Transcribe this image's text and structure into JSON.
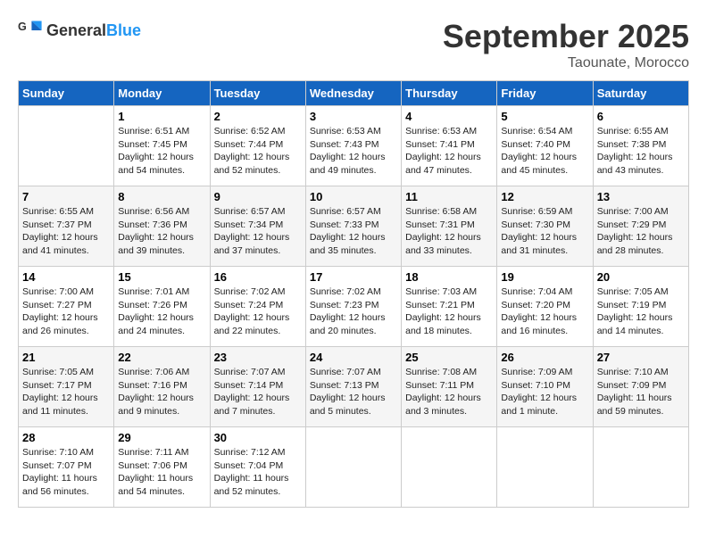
{
  "header": {
    "logo_general": "General",
    "logo_blue": "Blue",
    "month": "September 2025",
    "location": "Taounate, Morocco"
  },
  "days_of_week": [
    "Sunday",
    "Monday",
    "Tuesday",
    "Wednesday",
    "Thursday",
    "Friday",
    "Saturday"
  ],
  "weeks": [
    [
      {
        "day": "",
        "info": ""
      },
      {
        "day": "1",
        "info": "Sunrise: 6:51 AM\nSunset: 7:45 PM\nDaylight: 12 hours\nand 54 minutes."
      },
      {
        "day": "2",
        "info": "Sunrise: 6:52 AM\nSunset: 7:44 PM\nDaylight: 12 hours\nand 52 minutes."
      },
      {
        "day": "3",
        "info": "Sunrise: 6:53 AM\nSunset: 7:43 PM\nDaylight: 12 hours\nand 49 minutes."
      },
      {
        "day": "4",
        "info": "Sunrise: 6:53 AM\nSunset: 7:41 PM\nDaylight: 12 hours\nand 47 minutes."
      },
      {
        "day": "5",
        "info": "Sunrise: 6:54 AM\nSunset: 7:40 PM\nDaylight: 12 hours\nand 45 minutes."
      },
      {
        "day": "6",
        "info": "Sunrise: 6:55 AM\nSunset: 7:38 PM\nDaylight: 12 hours\nand 43 minutes."
      }
    ],
    [
      {
        "day": "7",
        "info": "Sunrise: 6:55 AM\nSunset: 7:37 PM\nDaylight: 12 hours\nand 41 minutes."
      },
      {
        "day": "8",
        "info": "Sunrise: 6:56 AM\nSunset: 7:36 PM\nDaylight: 12 hours\nand 39 minutes."
      },
      {
        "day": "9",
        "info": "Sunrise: 6:57 AM\nSunset: 7:34 PM\nDaylight: 12 hours\nand 37 minutes."
      },
      {
        "day": "10",
        "info": "Sunrise: 6:57 AM\nSunset: 7:33 PM\nDaylight: 12 hours\nand 35 minutes."
      },
      {
        "day": "11",
        "info": "Sunrise: 6:58 AM\nSunset: 7:31 PM\nDaylight: 12 hours\nand 33 minutes."
      },
      {
        "day": "12",
        "info": "Sunrise: 6:59 AM\nSunset: 7:30 PM\nDaylight: 12 hours\nand 31 minutes."
      },
      {
        "day": "13",
        "info": "Sunrise: 7:00 AM\nSunset: 7:29 PM\nDaylight: 12 hours\nand 28 minutes."
      }
    ],
    [
      {
        "day": "14",
        "info": "Sunrise: 7:00 AM\nSunset: 7:27 PM\nDaylight: 12 hours\nand 26 minutes."
      },
      {
        "day": "15",
        "info": "Sunrise: 7:01 AM\nSunset: 7:26 PM\nDaylight: 12 hours\nand 24 minutes."
      },
      {
        "day": "16",
        "info": "Sunrise: 7:02 AM\nSunset: 7:24 PM\nDaylight: 12 hours\nand 22 minutes."
      },
      {
        "day": "17",
        "info": "Sunrise: 7:02 AM\nSunset: 7:23 PM\nDaylight: 12 hours\nand 20 minutes."
      },
      {
        "day": "18",
        "info": "Sunrise: 7:03 AM\nSunset: 7:21 PM\nDaylight: 12 hours\nand 18 minutes."
      },
      {
        "day": "19",
        "info": "Sunrise: 7:04 AM\nSunset: 7:20 PM\nDaylight: 12 hours\nand 16 minutes."
      },
      {
        "day": "20",
        "info": "Sunrise: 7:05 AM\nSunset: 7:19 PM\nDaylight: 12 hours\nand 14 minutes."
      }
    ],
    [
      {
        "day": "21",
        "info": "Sunrise: 7:05 AM\nSunset: 7:17 PM\nDaylight: 12 hours\nand 11 minutes."
      },
      {
        "day": "22",
        "info": "Sunrise: 7:06 AM\nSunset: 7:16 PM\nDaylight: 12 hours\nand 9 minutes."
      },
      {
        "day": "23",
        "info": "Sunrise: 7:07 AM\nSunset: 7:14 PM\nDaylight: 12 hours\nand 7 minutes."
      },
      {
        "day": "24",
        "info": "Sunrise: 7:07 AM\nSunset: 7:13 PM\nDaylight: 12 hours\nand 5 minutes."
      },
      {
        "day": "25",
        "info": "Sunrise: 7:08 AM\nSunset: 7:11 PM\nDaylight: 12 hours\nand 3 minutes."
      },
      {
        "day": "26",
        "info": "Sunrise: 7:09 AM\nSunset: 7:10 PM\nDaylight: 12 hours\nand 1 minute."
      },
      {
        "day": "27",
        "info": "Sunrise: 7:10 AM\nSunset: 7:09 PM\nDaylight: 11 hours\nand 59 minutes."
      }
    ],
    [
      {
        "day": "28",
        "info": "Sunrise: 7:10 AM\nSunset: 7:07 PM\nDaylight: 11 hours\nand 56 minutes."
      },
      {
        "day": "29",
        "info": "Sunrise: 7:11 AM\nSunset: 7:06 PM\nDaylight: 11 hours\nand 54 minutes."
      },
      {
        "day": "30",
        "info": "Sunrise: 7:12 AM\nSunset: 7:04 PM\nDaylight: 11 hours\nand 52 minutes."
      },
      {
        "day": "",
        "info": ""
      },
      {
        "day": "",
        "info": ""
      },
      {
        "day": "",
        "info": ""
      },
      {
        "day": "",
        "info": ""
      }
    ]
  ]
}
